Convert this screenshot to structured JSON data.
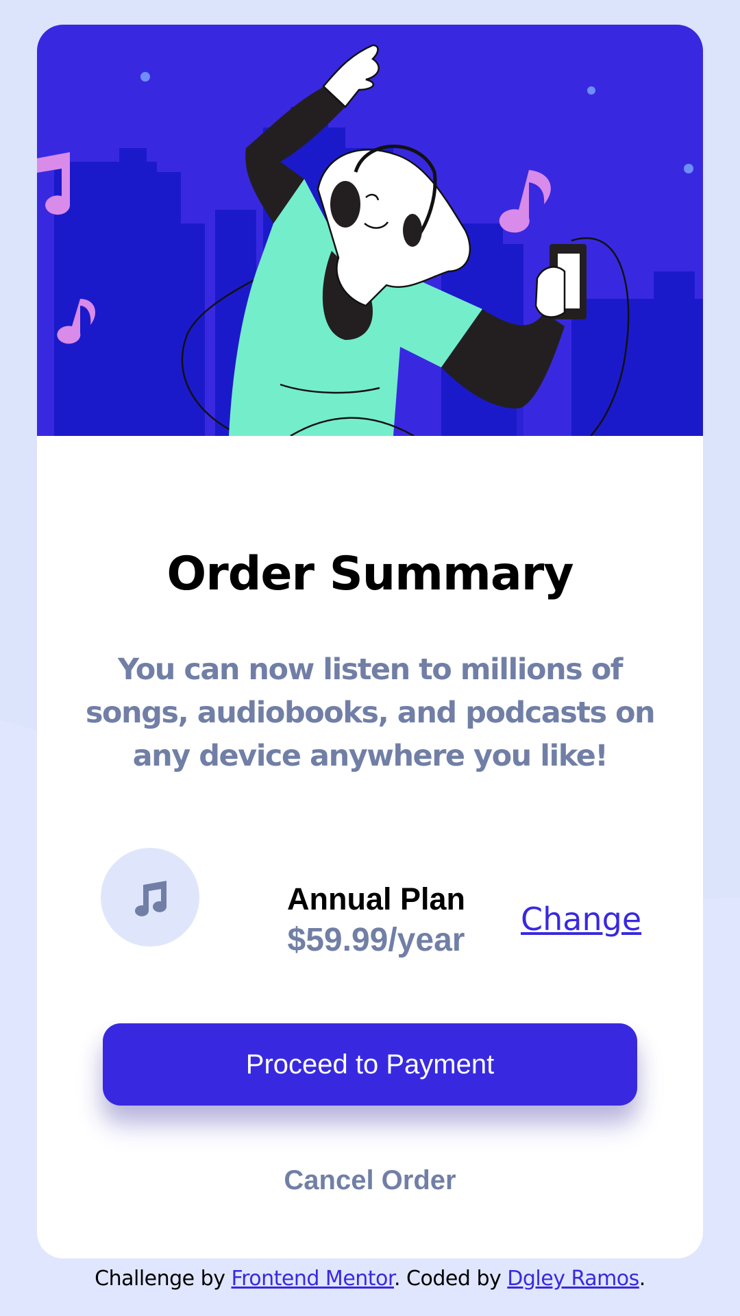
{
  "colors": {
    "page_background": "#dce4fb",
    "card_background": "#ffffff",
    "accent": "#3829e0",
    "muted_text": "#717fa6",
    "icon_circle": "#dfe6fb",
    "hero_shirt": "#74edcb",
    "hero_notes": "#d98bea"
  },
  "hero": {
    "image_icon": "dancing-person-with-headphones-illustration"
  },
  "card": {
    "title": "Order Summary",
    "description": "You can now listen to millions of songs, audiobooks, and podcasts on any device anywhere you like!"
  },
  "plan": {
    "icon": "music-note-icon",
    "name": "Annual Plan",
    "price": "$59.99/year",
    "change_label": "Change"
  },
  "actions": {
    "proceed_label": "Proceed to Payment",
    "cancel_label": "Cancel Order"
  },
  "attribution": {
    "prefix": "Challenge by ",
    "link1": "Frontend Mentor",
    "middle": ". Coded by ",
    "link2": "Dgley Ramos",
    "suffix": "."
  }
}
